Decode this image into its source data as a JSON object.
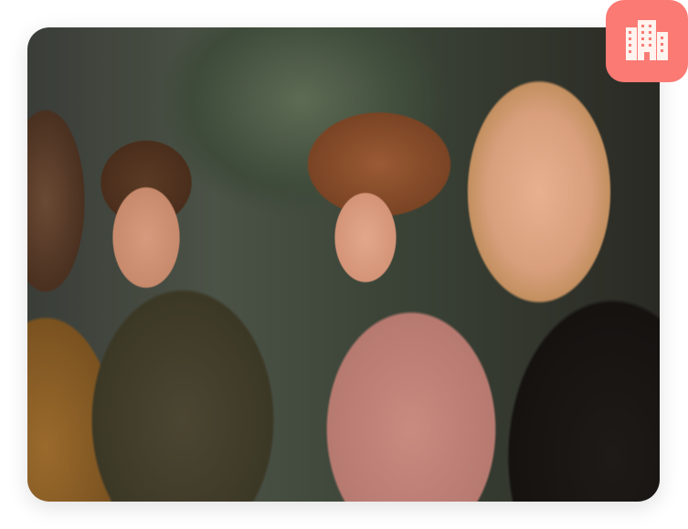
{
  "photo": {
    "subject": "people-smiling-photo"
  },
  "badge": {
    "icon": "building-icon",
    "color": "#fb7a74"
  }
}
